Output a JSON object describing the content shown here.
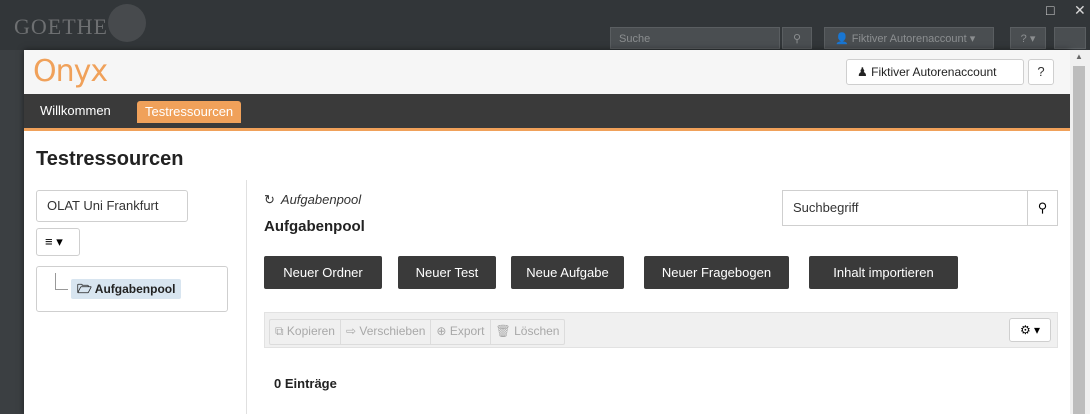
{
  "background": {
    "logo_text": "GOETHE",
    "search_placeholder": "Suche",
    "search_icon": "search-icon",
    "user_label": "Fiktiver Autorenaccount",
    "help_label": "?"
  },
  "window_controls": {
    "maximize": "□",
    "close": "✕"
  },
  "modal": {
    "logo": "Onyx",
    "account_label": "Fiktiver Autorenaccount",
    "help_icon": "?"
  },
  "nav": {
    "items": [
      {
        "label": "Willkommen"
      }
    ],
    "active": {
      "label": "Testressourcen"
    }
  },
  "page": {
    "title": "Testressourcen"
  },
  "left": {
    "org_button": "OLAT Uni Frankfurt",
    "menu_icon": "≡ ▾",
    "tree_node": "Aufgabenpool"
  },
  "main": {
    "breadcrumb": "Aufgabenpool",
    "title": "Aufgabenpool",
    "search_placeholder": "Suchbegriff",
    "actions": [
      {
        "label": "Neuer Ordner"
      },
      {
        "label": "Neuer Test"
      },
      {
        "label": "Neue Aufgabe"
      },
      {
        "label": "Neuer Fragebogen"
      },
      {
        "label": "Inhalt importieren"
      }
    ],
    "toolbar": [
      {
        "label": "Kopieren"
      },
      {
        "label": "Verschieben"
      },
      {
        "label": "Export"
      },
      {
        "label": "Löschen"
      }
    ],
    "gear_label": "⚙ ▾",
    "entries": "0 Einträge"
  },
  "colors": {
    "accent": "#f0a15a",
    "nav_bg": "#3a3a3a",
    "button_bg": "#3a3a3a"
  }
}
